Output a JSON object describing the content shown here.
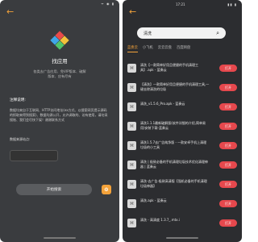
{
  "left": {
    "status": {
      "time": "",
      "icons": "ᯤ ◉ ▮"
    },
    "back_icon": "←",
    "app_title": "找应用",
    "app_desc": "各类去广告应用、免VIP版本、破解\n版本、应有尽有",
    "notes_heading": "注释说明:",
    "notes_body": "数据均来自于互联网、HTTP访问地址(ex方式、以搜索网页提示源码的抓取来得到搜索)、数据均源公开，允许调取的、访有使用，请勿采搜账、我们会尽快下架！谢谢联系方式",
    "source_label": "数据来源站点:",
    "start_button": "开始搜索",
    "side_icon": "❂"
  },
  "right": {
    "status": {
      "time": "17:21",
      "icons": "▮▮ ▮"
    },
    "back_icon": "←",
    "search_value": "清洗",
    "search_icon": "⌕",
    "tabs": [
      "蓝奏云",
      "小飞机",
      "云云云盘",
      "百度网盘"
    ],
    "open_label": "打开",
    "items": [
      {
        "title": "清洗【一款简单好用且便捷的手机清理工具】.apk - 蓝奏云",
        "has_button": true
      },
      {
        "title": "【清洗】一款简单好用且便捷的手机清理工具,一键去除清洗的垃圾",
        "has_button": true
      },
      {
        "title": "清洗_v1.5.6_Pro.apk - 蓝奏云",
        "has_button": true
      },
      {
        "title": "清洗1.1.1最新破解版(软件详细的介绍,简单易用)安装下载-蓝奏云",
        "has_button": true
      },
      {
        "title": "清洗1.5.7去广告纯净版 - 一款安卓手机上清理垃圾的小工具",
        "has_button": true
      },
      {
        "title": "清洗 | 极致必备的手机清理垃圾技术优化清理神器 | 蓝奏云",
        "has_button": true
      },
      {
        "title": "清洗-去广告·极致高清版【强机必备的手机清理垃圾神器】",
        "has_button": true
      },
      {
        "title": "清洗.apk - 蓝奏云",
        "has_button": true
      },
      {
        "title": "清洗 - 高清度 1.3.7_.mtx.i",
        "has_button": true
      }
    ]
  },
  "colors": {
    "accent": "#f3a23a",
    "open_button": "#e6484d"
  }
}
